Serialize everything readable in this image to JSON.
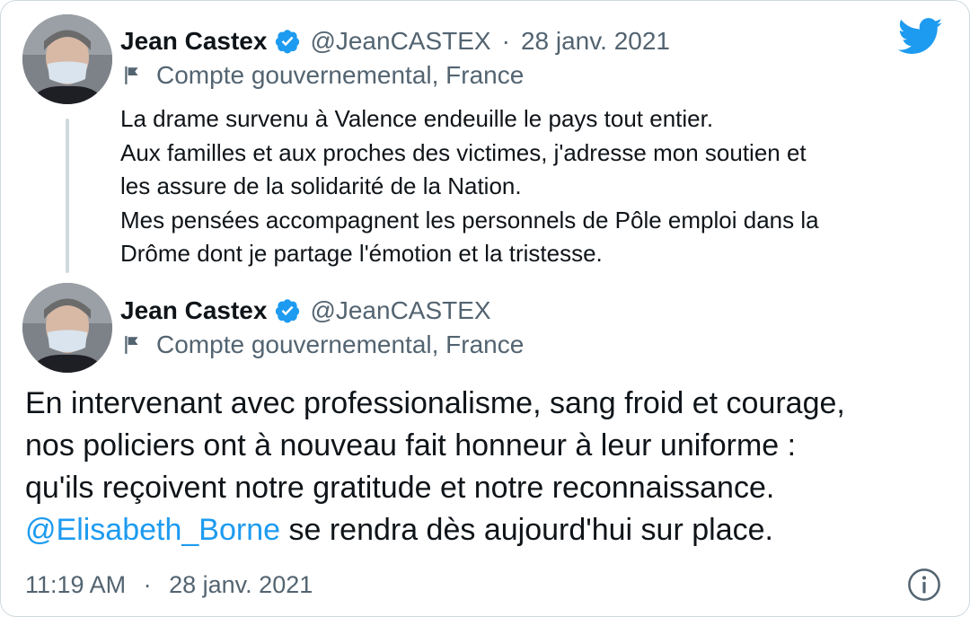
{
  "brand_color": "#1d9bf0",
  "quoted_tweet": {
    "author_name": "Jean Castex",
    "handle": "@JeanCASTEX",
    "separator": "·",
    "date": "28 janv. 2021",
    "label": "Compte gouvernemental, France",
    "lines": [
      "La drame survenu à Valence endeuille le pays tout entier.",
      "Aux familles et aux proches des victimes, j'adresse mon soutien et",
      "les assure de la solidarité de la Nation.",
      "Mes pensées accompagnent les personnels de Pôle emploi dans la",
      "Drôme dont je partage l'émotion et la tristesse."
    ]
  },
  "main_tweet": {
    "author_name": "Jean Castex",
    "handle": "@JeanCASTEX",
    "label": "Compte gouvernemental, France",
    "lines": [
      "En intervenant avec professionalisme, sang froid et courage,",
      "nos policiers ont à nouveau fait honneur à leur uniforme :",
      "qu'ils reçoivent notre gratitude et notre reconnaissance."
    ],
    "mention": "@Elisabeth_Borne",
    "last_line_rest": " se rendra dès aujourd'hui sur place.",
    "time": "11:19 AM",
    "separator": "·",
    "date": "28 janv. 2021"
  },
  "icons": [
    "twitter-bird-icon",
    "verified-badge-icon",
    "flag-icon",
    "info-icon"
  ]
}
